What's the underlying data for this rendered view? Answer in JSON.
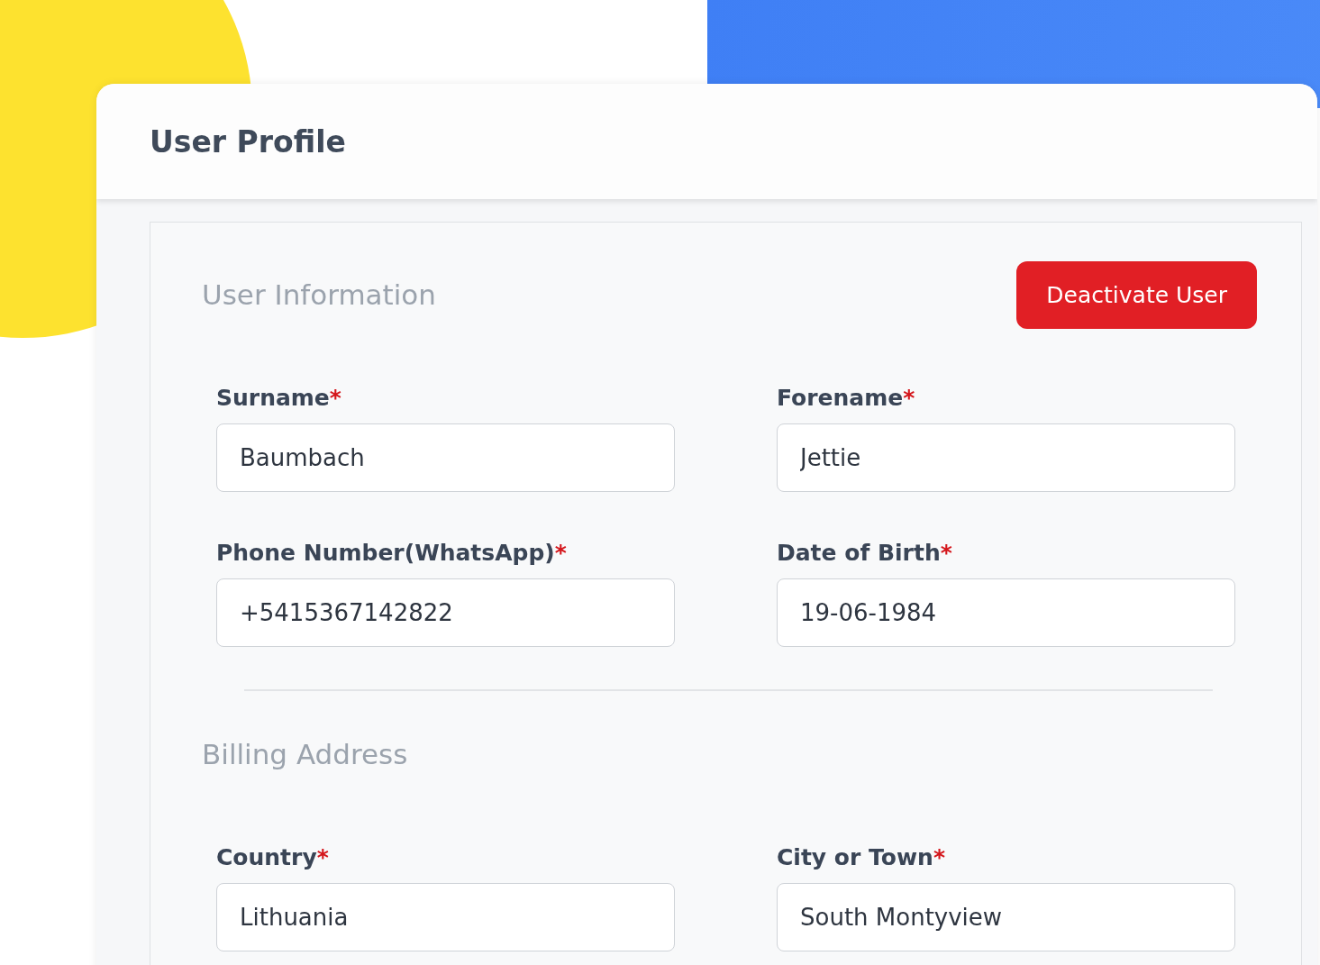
{
  "card": {
    "title": "User Profile"
  },
  "sections": [
    {
      "heading": "User Information",
      "button": {
        "label": "Deactivate User"
      },
      "fields": [
        {
          "label": "Surname",
          "asterisk": "*",
          "value": "Baumbach"
        },
        {
          "label": "Forename",
          "asterisk": "*",
          "value": "Jettie"
        },
        {
          "label": "Phone Number(WhatsApp)",
          "asterisk": "*",
          "value": "+5415367142822"
        },
        {
          "label": "Date of Birth",
          "asterisk": "*",
          "value": "19-06-1984"
        }
      ]
    },
    {
      "heading": "Billing Address",
      "fields": [
        {
          "label": "Country",
          "asterisk": "*",
          "value": "Lithuania"
        },
        {
          "label": "City or Town",
          "asterisk": "*",
          "value": "South Montyview"
        }
      ]
    }
  ]
}
